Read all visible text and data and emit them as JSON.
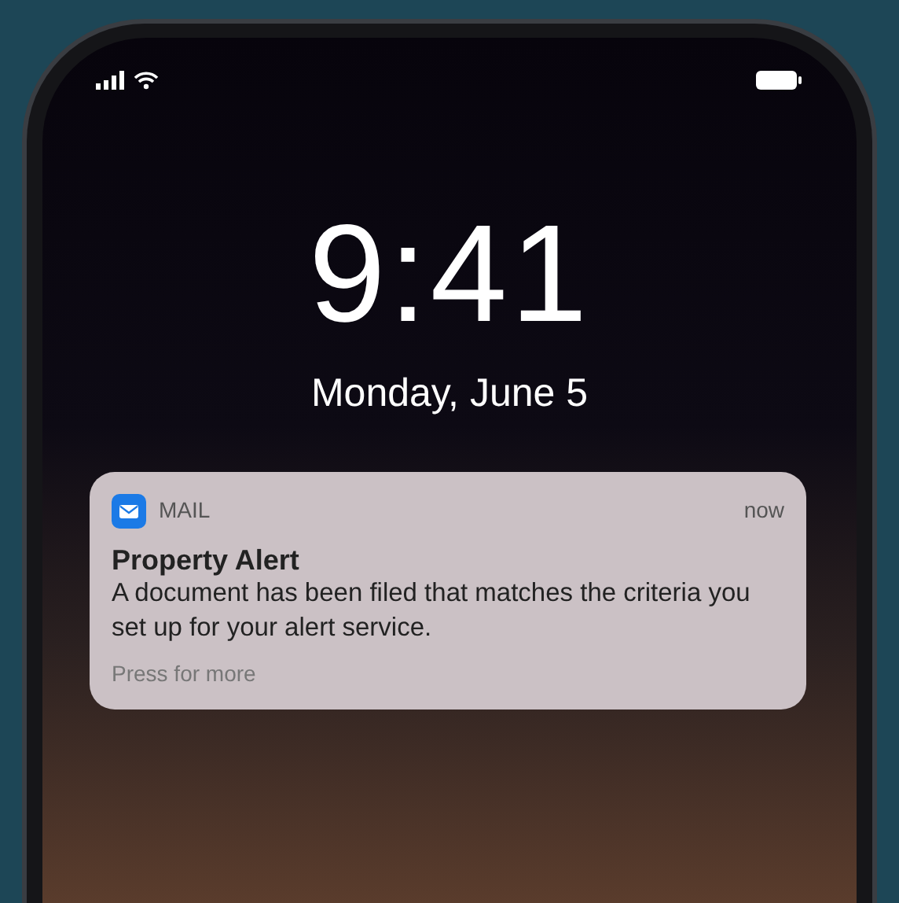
{
  "lock_screen": {
    "time": "9:41",
    "date": "Monday, June 5"
  },
  "notification": {
    "app": "MAIL",
    "time": "now",
    "title": "Property Alert",
    "body": "A document has been filed that matches the criteria you set up for your alert service.",
    "hint": "Press for more"
  }
}
